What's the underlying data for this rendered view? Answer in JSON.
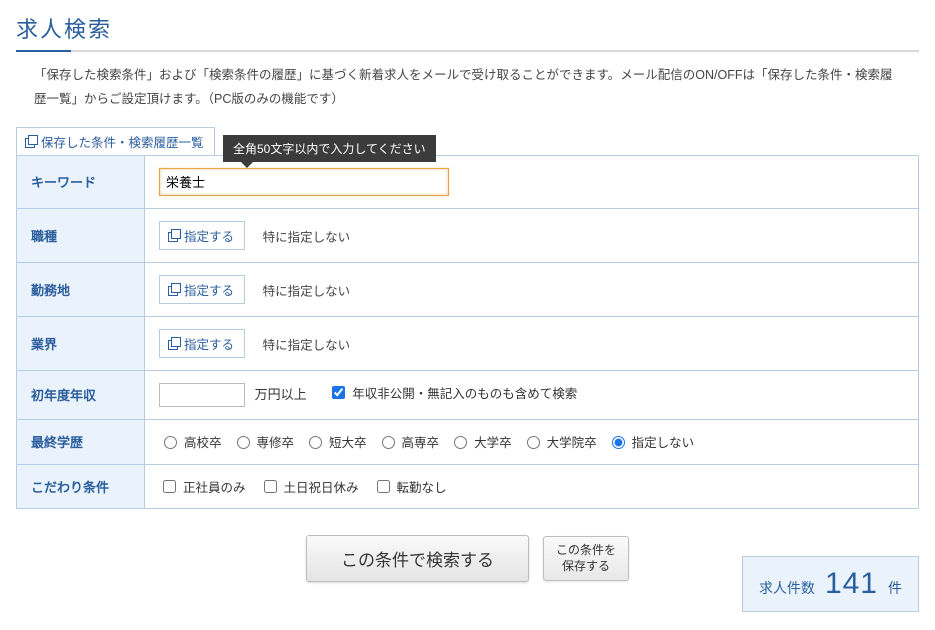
{
  "title": "求人検索",
  "description": "「保存した検索条件」および「検索条件の履歴」に基づく新着求人をメールで受け取ることができます。メール配信のON/OFFは「保存した条件・検索履歴一覧」からご設定頂けます。（PC版のみの機能です）",
  "historyLink": "保存した条件・検索履歴一覧",
  "tooltip": "全角50文字以内で入力してください",
  "labels": {
    "keyword": "キーワード",
    "jobType": "職種",
    "location": "勤務地",
    "industry": "業界",
    "salary": "初年度年収",
    "education": "最終学歴",
    "preferences": "こだわり条件"
  },
  "common": {
    "specifyBtn": "指定する",
    "notSpecified": "特に指定しない"
  },
  "keyword": {
    "value": "栄養士"
  },
  "salary": {
    "value": "",
    "unit": "万円以上",
    "includeUndisclosed": {
      "checked": true,
      "label": "年収非公開・無記入のものも含めて検索"
    }
  },
  "education": {
    "options": [
      {
        "id": "hs",
        "label": "高校卒",
        "checked": false
      },
      {
        "id": "sen",
        "label": "専修卒",
        "checked": false
      },
      {
        "id": "jc",
        "label": "短大卒",
        "checked": false
      },
      {
        "id": "kt",
        "label": "高専卒",
        "checked": false
      },
      {
        "id": "uni",
        "label": "大学卒",
        "checked": false
      },
      {
        "id": "grad",
        "label": "大学院卒",
        "checked": false
      },
      {
        "id": "none",
        "label": "指定しない",
        "checked": true
      }
    ]
  },
  "preferences": {
    "options": [
      {
        "id": "fulltime",
        "label": "正社員のみ",
        "checked": false
      },
      {
        "id": "weekend",
        "label": "土日祝日休み",
        "checked": false
      },
      {
        "id": "notrans",
        "label": "転勤なし",
        "checked": false
      }
    ]
  },
  "buttons": {
    "search": "この条件で検索する",
    "save": "この条件を\n保存する"
  },
  "result": {
    "label": "求人件数",
    "count": "141",
    "unit": "件"
  }
}
